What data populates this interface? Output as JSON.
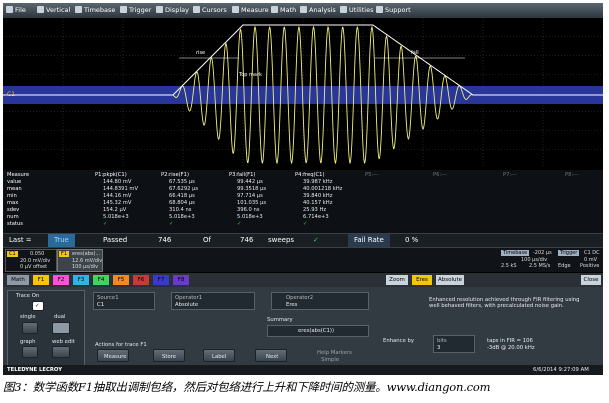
{
  "menu": [
    "File",
    "Vertical",
    "Timebase",
    "Trigger",
    "Display",
    "Cursors",
    "Measure",
    "Math",
    "Analysis",
    "Utilities",
    "Support"
  ],
  "screen": {
    "trace_label": "C1",
    "cursor_labels": {
      "rise": "rise",
      "fall": "fall",
      "top": "Top mark"
    }
  },
  "measure": {
    "row_labels": [
      "Measure",
      "value",
      "mean",
      "min",
      "max",
      "sdev",
      "num",
      "status"
    ],
    "columns": [
      {
        "name": "P1:pkpk(C1)",
        "values": [
          "144.80 mV",
          "144.8391 mV",
          "144.16 mV",
          "145.32 mV",
          "154.2 µV",
          "5.018e+3",
          "✓"
        ]
      },
      {
        "name": "P2:rise(F1)",
        "values": [
          "67.535 µs",
          "67.6292 µs",
          "66.418 µs",
          "68.804 µs",
          "310.4 ns",
          "5.018e+3",
          "✓"
        ]
      },
      {
        "name": "P3:fall(F1)",
        "values": [
          "99.442 µs",
          "99.3518 µs",
          "97.714 µs",
          "101.035 µs",
          "396.0 ns",
          "5.018e+3",
          "✓"
        ]
      },
      {
        "name": "P4:freq(C1)",
        "values": [
          "39.987 kHz",
          "40.001218 kHz",
          "39.840 kHz",
          "40.157 kHz",
          "25.93 Hz",
          "6.714e+3",
          "✓"
        ]
      },
      {
        "name": "P5:---",
        "values": [
          "",
          "",
          "",
          "",
          "",
          "",
          ""
        ]
      },
      {
        "name": "P6:---",
        "values": [
          "",
          "",
          "",
          "",
          "",
          "",
          ""
        ]
      },
      {
        "name": "P7:---",
        "values": [
          "",
          "",
          "",
          "",
          "",
          "",
          ""
        ]
      },
      {
        "name": "P8:---",
        "values": [
          "",
          "",
          "",
          "",
          "",
          "",
          ""
        ]
      }
    ]
  },
  "last_row": {
    "label": "Last =",
    "cond": "True",
    "passed": "Passed",
    "n1": "746",
    "of": "Of",
    "n2": "746",
    "sweeps": "sweeps",
    "fail_label": "Fail Rate",
    "fail_val": "0 %"
  },
  "channels": {
    "c1": {
      "tag": "C1",
      "offset": "0.050",
      "vdiv": "20.0 mV/div",
      "off": "0 µV offset"
    },
    "f1": {
      "tag": "F1",
      "func": "eres(abs(...",
      "vdiv": "12.6 mV/div",
      "tdiv": "100 µs/div"
    },
    "timebase": {
      "label": "Timebase",
      "val": "-202 µs",
      "r1": "100 µs/div",
      "r2": "2.5 kS",
      "r3": "2.5 MS/s"
    },
    "trigger": {
      "label": "Trigger",
      "val": "C1 DC",
      "r1": "0 mV",
      "r2": "Edge",
      "r3": "Positive"
    }
  },
  "tabs": {
    "left": [
      "Math",
      "F1",
      "F2",
      "F3",
      "F4",
      "F5",
      "F6",
      "F7",
      "F8"
    ],
    "right": [
      "Zoom",
      "Eres",
      "Absolute"
    ],
    "close": "Close"
  },
  "panel": {
    "trace_on": "Trace On",
    "single": "single",
    "dual": "dual",
    "graph": "graph",
    "web_edit": "web edit",
    "source_label": "Source1",
    "source_val": "C1",
    "op1_label": "Operator1",
    "op1_val": "Absolute",
    "op2_label": "Operator2",
    "op2_val": "Eres",
    "summary_label": "Summary",
    "summary_val": "eres(abs(C1))",
    "actions": "Actions for trace F1",
    "buttons": [
      "Measure",
      "Store",
      "Label",
      "Next"
    ],
    "help": "Help Markers",
    "help_val": "Simple",
    "eres_desc": "Enhanced resolution achieved through FIR filtering using well behaved filters, with precalculated noise gain.",
    "enhance_label": "Enhance by",
    "bits_label": "bits",
    "bits_val": "3",
    "taps": "taps in FIR = 106",
    "db": "-3dB @ 20.00 kHz"
  },
  "status": {
    "brand": "TELEDYNE LECROY",
    "date": "6/6/2014 9:27:09 AM"
  },
  "caption": "图3：数学函数F1抽取出调制包络，然后对包络进行上升和下降时间的测量。www.diangon.com",
  "colors": {
    "trace": "#f2ef7a",
    "grid_band": "#2f3fb4",
    "grid": "#3a3a3a",
    "f1": "#f2c800"
  }
}
